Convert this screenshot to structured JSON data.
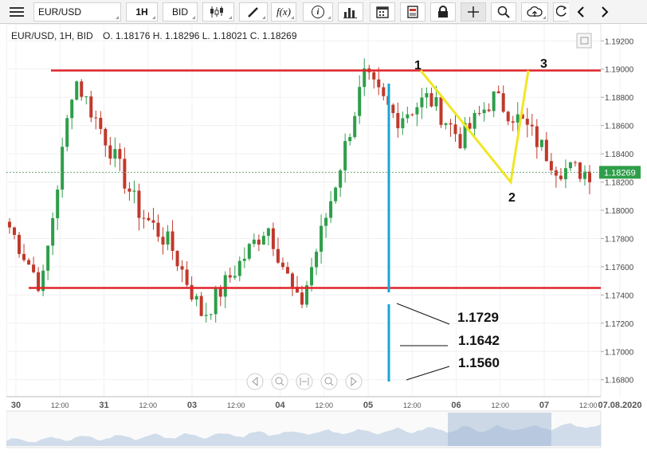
{
  "toolbar": {
    "symbol": "EUR/USD",
    "timeframe": "1H",
    "price_side": "BID",
    "function_label": "f(x)",
    "info_label": "i",
    "icons": [
      "menu-icon",
      "candle-type-icon",
      "draw-icon",
      "function-icon",
      "info-icon",
      "bar-chart-icon",
      "calendar-icon",
      "report-icon",
      "lock-icon",
      "crosshair-icon",
      "zoom-icon",
      "cloud-upload-icon",
      "refresh-icon",
      "prev-icon",
      "next-icon"
    ]
  },
  "header": {
    "legend": "EUR/USD, 1H, BID",
    "ohlc": "O. 1.18176 H. 1.18296 L. 1.18021 C. 1.18269"
  },
  "colors": {
    "bull": "#2e9e4a",
    "bear": "#c0392b",
    "resistance": "#e0242a",
    "vertical": "#1ba4d6",
    "pattern": "#f0e626",
    "current_price_tag": "#2e9e4a"
  },
  "chart_data": {
    "type": "candlestick",
    "symbol": "EUR/USD",
    "interval": "1H",
    "ohlc_last": {
      "open": 1.18176,
      "high": 1.18296,
      "low": 1.18021,
      "close": 1.18269
    },
    "ylim": [
      1.1668,
      1.1932
    ],
    "y_ticks": [
      "1.19200",
      "1.19000",
      "1.18800",
      "1.18600",
      "1.18400",
      "1.18200",
      "1.18000",
      "1.17800",
      "1.17600",
      "1.17400",
      "1.17200",
      "1.17000",
      "1.16800"
    ],
    "x_ticks": [
      "30",
      "12:00",
      "31",
      "12:00",
      "03",
      "12:00",
      "04",
      "12:00",
      "05",
      "12:00",
      "06",
      "12:00",
      "07",
      "12:00",
      "07.08.2020"
    ],
    "current_price": "1.18269",
    "horizontal_lines": [
      {
        "value": 1.1899
      },
      {
        "value": 1.1745
      }
    ],
    "pattern_labels": [
      "1",
      "2",
      "3"
    ],
    "pattern_points": [
      {
        "label": "1",
        "price": 1.1899
      },
      {
        "label": "2",
        "price": 1.182
      },
      {
        "label": "3",
        "price": 1.1899
      }
    ],
    "annotation_values": [
      "1.1729",
      "1.1642",
      "1.1560"
    ],
    "close_path": [
      [
        "30",
        1.1788
      ],
      [
        "30 12:00",
        1.1745
      ],
      [
        "31",
        1.1895
      ],
      [
        "31 12:00",
        1.185
      ],
      [
        "03",
        1.18
      ],
      [
        "03 12:00",
        1.1775
      ],
      [
        "03 12:00",
        1.1725
      ],
      [
        "04",
        1.1758
      ],
      [
        "04 12:00",
        1.179
      ],
      [
        "04 12:00",
        1.173
      ],
      [
        "05",
        1.181
      ],
      [
        "05 12:00",
        1.1895
      ],
      [
        "06",
        1.1865
      ],
      [
        "06",
        1.188
      ],
      [
        "06 12:00",
        1.185
      ],
      [
        "06 12:00",
        1.188
      ],
      [
        "07",
        1.186
      ],
      [
        "07",
        1.183
      ],
      [
        "07 12:00",
        1.1827
      ]
    ]
  }
}
